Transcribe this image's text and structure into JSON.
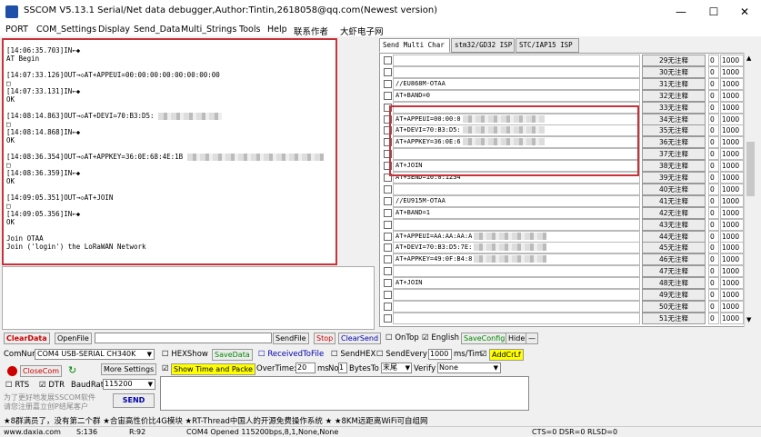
{
  "window": {
    "title": "SSCOM V5.13.1 Serial/Net data debugger,Author:Tintin,2618058@qq.com(Newest version)",
    "minimize": "—",
    "maximize": "☐",
    "close": "✕"
  },
  "menu": [
    "PORT",
    "COM_Settings",
    "Display",
    "Send_Data",
    "Multi_Strings",
    "Tools",
    "Help",
    "联系作者",
    "大虾电子网"
  ],
  "receive_lines": [
    "[14:06:35.703]IN←◆",
    "AT Begin",
    "",
    "[14:07:33.126]OUT→◇AT+APPEUI=00:00:00:00:00:00:00:00",
    "□",
    "[14:07:33.131]IN←◆",
    "OK",
    "",
    "[14:08:14.863]OUT→◇AT+DEVI=70:B3:D5:",
    "□",
    "[14:08:14.868]IN←◆",
    "OK",
    "",
    "[14:08:36.354]OUT→◇AT+APPKEY=36:0E:68:4E:1B",
    "□",
    "[14:08:36.359]IN←◆",
    "OK",
    "",
    "[14:09:05.351]OUT→◇AT+JOIN",
    "□",
    "[14:09:05.356]IN←◆",
    "OK",
    "",
    "Join OTAA",
    "Join ('login') the LoRaWAN Network"
  ],
  "tabs": [
    "Send Multi Char",
    "stm32/GD32 ISP",
    "STC/IAP15 ISP"
  ],
  "send_rows": [
    {
      "cmd": "",
      "btn": "29无注释",
      "n": "0",
      "ms": "1000"
    },
    {
      "cmd": "",
      "btn": "30无注释",
      "n": "0",
      "ms": "1000"
    },
    {
      "cmd": "//EU868M-OTAA",
      "btn": "31无注释",
      "n": "0",
      "ms": "1000"
    },
    {
      "cmd": "AT+BAND=0",
      "btn": "32无注释",
      "n": "0",
      "ms": "1000"
    },
    {
      "cmd": "",
      "btn": "33无注释",
      "n": "0",
      "ms": "1000"
    },
    {
      "cmd": "AT+APPEUI=00:00:0",
      "btn": "34无注释",
      "n": "0",
      "ms": "1000"
    },
    {
      "cmd": "AT+DEVI=70:B3:D5:",
      "btn": "35无注释",
      "n": "0",
      "ms": "1000"
    },
    {
      "cmd": "AT+APPKEY=36:0E:6",
      "btn": "36无注释",
      "n": "0",
      "ms": "1000"
    },
    {
      "cmd": "",
      "btn": "37无注释",
      "n": "0",
      "ms": "1000"
    },
    {
      "cmd": "AT+JOIN",
      "btn": "38无注释",
      "n": "0",
      "ms": "1000"
    },
    {
      "cmd": "AT+SEND=10:0:1234",
      "btn": "39无注释",
      "n": "0",
      "ms": "1000"
    },
    {
      "cmd": "",
      "btn": "40无注释",
      "n": "0",
      "ms": "1000"
    },
    {
      "cmd": "//EU915M-OTAA",
      "btn": "41无注释",
      "n": "0",
      "ms": "1000"
    },
    {
      "cmd": "AT+BAND=1",
      "btn": "42无注释",
      "n": "0",
      "ms": "1000"
    },
    {
      "cmd": "",
      "btn": "43无注释",
      "n": "0",
      "ms": "1000"
    },
    {
      "cmd": "AT+APPEUI=AA:AA:AA:A",
      "btn": "44无注释",
      "n": "0",
      "ms": "1000"
    },
    {
      "cmd": "AT+DEVI=70:B3:D5:7E:",
      "btn": "45无注释",
      "n": "0",
      "ms": "1000"
    },
    {
      "cmd": "AT+APPKEY=49:0F:B4:8",
      "btn": "46无注释",
      "n": "0",
      "ms": "1000"
    },
    {
      "cmd": "",
      "btn": "47无注释",
      "n": "0",
      "ms": "1000"
    },
    {
      "cmd": "AT+JOIN",
      "btn": "48无注释",
      "n": "0",
      "ms": "1000"
    },
    {
      "cmd": "",
      "btn": "49无注释",
      "n": "0",
      "ms": "1000"
    },
    {
      "cmd": "",
      "btn": "50无注释",
      "n": "0",
      "ms": "1000"
    },
    {
      "cmd": "",
      "btn": "51无注释",
      "n": "0",
      "ms": "1000"
    }
  ],
  "controls": {
    "cleardata": "ClearData",
    "openfile": "OpenFile",
    "sendfile": "SendFile",
    "stop": "Stop",
    "clearsend": "ClearSend",
    "ontop": "OnTop",
    "english": "English",
    "saveconfig": "SaveConfig",
    "hide": "Hide",
    "dash": "—",
    "comnum": "ComNum",
    "com_value": "COM4 USB-SERIAL CH340K",
    "hexshow": "HEXShow",
    "savedata": "SaveData",
    "receivedtofile": "ReceivedToFile",
    "sendhex": "SendHEX",
    "sendevery": "SendEvery",
    "every_ms": "1000",
    "mstim": "ms/Tim",
    "addcrlf": "AddCrLf",
    "closecom": "CloseCom",
    "moresetting": "More Settings",
    "showtime": "Show Time and Packe",
    "overtime": "OverTime:",
    "overtime_value": "20",
    "ms": "ms",
    "no": "No",
    "no_value": "1",
    "bytesto": "BytesTo",
    "tail": "末尾",
    "verify": "Verify",
    "verify_value": "None",
    "rts": "RTS",
    "dtr": "DTR",
    "baudrate": "BaudRat",
    "baud_value": "115200",
    "send": "SEND",
    "promo1": "为了更好地发展SSCOM软件",
    "promo2": "请您注册嘉立创P结尾客户"
  },
  "banner": "★8群满员了，没有第二个群 ★合宙高性价比4G模块 ★RT-Thread中国人的开源免费操作系统 ★ ★8KM远距离WiFi可自组网",
  "status": {
    "url": "www.daxia.com",
    "s": "S:136",
    "r": "R:92",
    "port": "COM4 Opened  115200bps,8,1,None,None",
    "cts": "CTS=0 DSR=0 RLSD=0"
  }
}
